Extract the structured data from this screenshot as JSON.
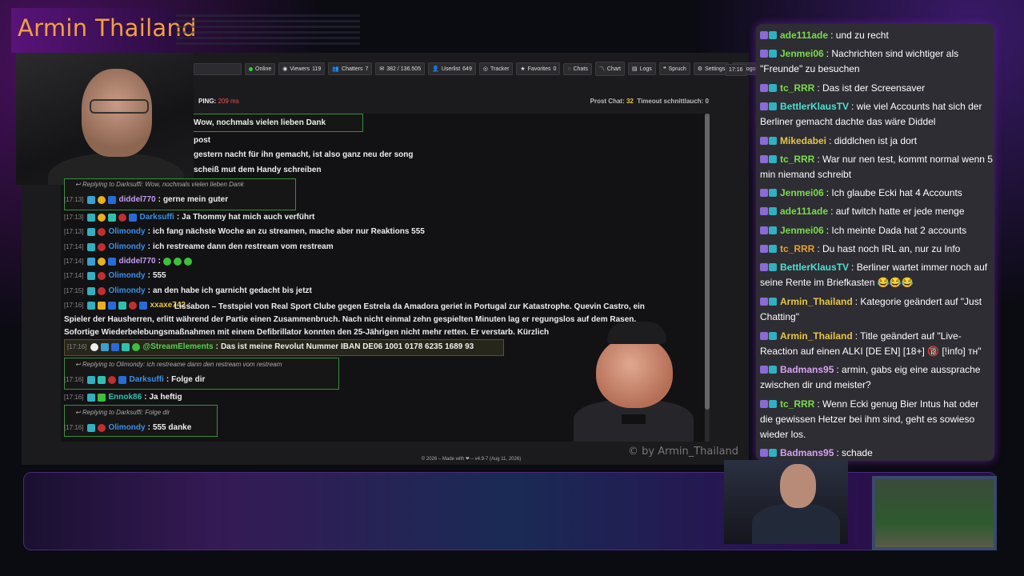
{
  "stream_title": "Armin Thailand",
  "toolbar": {
    "online": "Online",
    "viewers_label": "Viewers",
    "viewers": "119",
    "chatters_label": "Chatters",
    "chatters": "7",
    "messages": "382 / 136.505",
    "userlist_label": "Userlist",
    "userlist": "649",
    "tracker": "Tracker",
    "favorites_label": "Favorites",
    "favorites": "0",
    "chats": "Chats",
    "chart": "Chart",
    "logs": "Logs",
    "spruch": "Spruch",
    "settings": "Settings",
    "logout": "Logout",
    "time": "17:16"
  },
  "status": {
    "ping_label": "PING:",
    "ping_value": "209 ms",
    "prost_label": "Prost Chat:",
    "prost_value": "32",
    "timeout_label": "Timeout schnittlauch:",
    "timeout_value": "0"
  },
  "partial_lines": [
    "Wow, nochmals vielen lieben Dank",
    "post",
    "gestern nacht für ihn gemacht, ist also ganz neu der song",
    "scheiß mut dem Handy schreiben"
  ],
  "messages": [
    {
      "reply": "Replying to Darksuffi: Wow, nochmals vielen lieben Dank",
      "ts": "[17:13]",
      "user": "diddel770",
      "color": "#c49cf0",
      "text": "gerne mein guter"
    },
    {
      "ts": "[17:13]",
      "user": "Darksuffi",
      "color": "#3a8ee6",
      "text": "Ja Thommy hat mich auch verführt"
    },
    {
      "ts": "[17:13]",
      "user": "Olimondy",
      "color": "#3a8ee6",
      "text": "ich fang nächste Woche an zu streamen, mache aber nur Reaktions 555"
    },
    {
      "ts": "[17:14]",
      "user": "Olimondy",
      "color": "#3a8ee6",
      "text": "ich restreame dann den restream vom restream"
    },
    {
      "ts": "[17:14]",
      "user": "diddel770",
      "color": "#c49cf0",
      "text": ""
    },
    {
      "ts": "[17:14]",
      "user": "Olimondy",
      "color": "#3a8ee6",
      "text": "555"
    },
    {
      "ts": "[17:15]",
      "user": "Olimondy",
      "color": "#3a8ee6",
      "text": "an den habe ich garnicht gedacht bis jetzt"
    },
    {
      "ts": "[17:16]",
      "user": "xxaxe742",
      "color": "#e8c542",
      "text": "Lissabon – Testspiel von Real Sport Clube gegen Estrela da Amadora geriet in Portugal zur Katastrophe. Quevin Castro, ein Spieler der Hausherren, erlitt während der Partie einen Zusammenbruch. Nach nicht einmal zehn gespielten Minuten lag er regungslos auf dem Rasen. Sofortige Wiederbelebungsmaßnahmen mit einem Defibrillator konnten den 25-Jährigen nicht mehr retten. Er verstarb. Kürzlich"
    },
    {
      "ts": "[17:16]",
      "user": "@StreamElements",
      "color": "#55d055",
      "text": "Das ist meine Revolut Nummer IBAN DE06 1001 0178 6235 1689 93"
    },
    {
      "reply": "Replying to Olimondy: ich restreame dann den restream vom restream",
      "ts": "[17:16]",
      "user": "Darksuffi",
      "color": "#3a8ee6",
      "text": "Folge dir"
    },
    {
      "ts": "[17:16]",
      "user": "Ennok86",
      "color": "#30c0b0",
      "text": "Ja heftig"
    },
    {
      "reply": "Replying to Darksuffi: Folge dir",
      "ts": "[17:16]",
      "user": "Olimondy",
      "color": "#3a8ee6",
      "text": "555 danke"
    }
  ],
  "footer": "© 2026 – Made with ❤ – v4.9-7 (Aug 11, 2026)",
  "watermark": "© by Armin_Thailand",
  "side_chat": [
    {
      "user": "ade111ade",
      "color": "#7cdc4a",
      "text": ": und zu recht"
    },
    {
      "user": "Jenmei06",
      "color": "#7cdc4a",
      "text": ": Nachrichten sind wichtiger als \"Freunde\" zu besuchen"
    },
    {
      "user": "tc_RRR",
      "color": "#7cdc4a",
      "text": ": Das ist der Screensaver"
    },
    {
      "user": "BettlerKlausTV",
      "color": "#4ee0d0",
      "text": ": wie viel Accounts hat sich der Berliner gemacht dachte das wäre Diddel"
    },
    {
      "user": "Mikedabei",
      "color": "#e8c542",
      "text": ": diddlchen ist ja dort"
    },
    {
      "user": "tc_RRR",
      "color": "#7cdc4a",
      "text": ": War nur nen test, kommt normal wenn 5 min niemand schreibt"
    },
    {
      "user": "Jenmei06",
      "color": "#7cdc4a",
      "text": ": Ich glaube Ecki hat 4 Accounts"
    },
    {
      "user": "ade111ade",
      "color": "#7cdc4a",
      "text": ": auf twitch hatte er jede menge"
    },
    {
      "user": "Jenmei06",
      "color": "#7cdc4a",
      "text": ": Ich meinte Dada hat 2 accounts"
    },
    {
      "user": "tc_RRR",
      "color": "#e8a030",
      "text": ": Du hast noch IRL an, nur zu Info"
    },
    {
      "user": "BettlerKlausTV",
      "color": "#4ee0d0",
      "text": ": Berliner wartet immer noch auf seine Rente im Briefkasten 😂😂😂"
    },
    {
      "user": "Armin_Thailand",
      "color": "#e8c542",
      "text": ": Kategorie geändert auf \"Just Chatting\""
    },
    {
      "user": "Armin_Thailand",
      "color": "#e8c542",
      "text": ": Title geändert auf \"Live-Reaction auf einen ALKI [DE EN] [18+] 🔞 [!info] тн\""
    },
    {
      "user": "Badmans95",
      "color": "#d8a0f0",
      "text": ": armin, gabs eig eine aussprache zwischen dir und meister?"
    },
    {
      "user": "tc_RRR",
      "color": "#7cdc4a",
      "text": ": Wenn Ecki genug Bier Intus hat oder die gewissen Hetzer bei ihm sind, geht es sowieso wieder los."
    },
    {
      "user": "Badmans95",
      "color": "#d8a0f0",
      "text": ": schade"
    }
  ]
}
